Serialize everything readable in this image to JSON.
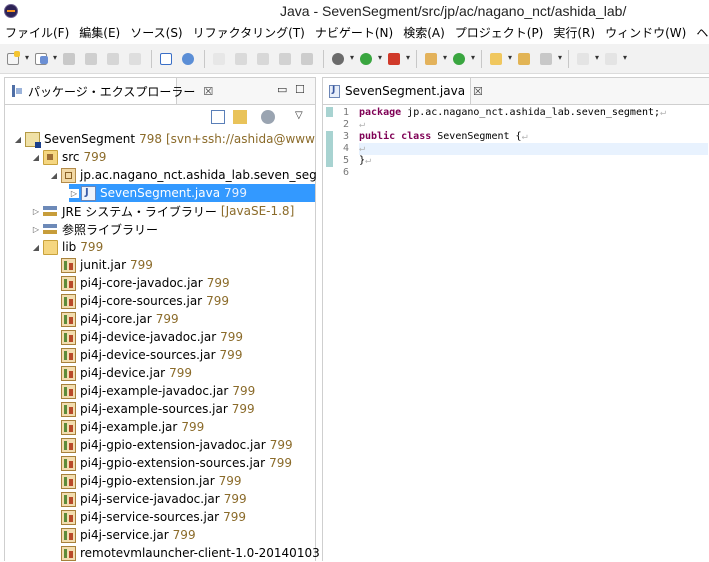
{
  "window": {
    "title": "Java - SevenSegment/src/jp/ac/nagano_nct/ashida_lab/"
  },
  "menubar": [
    {
      "label": "ファイル(F)"
    },
    {
      "label": "編集(E)"
    },
    {
      "label": "ソース(S)"
    },
    {
      "label": "リファクタリング(T)"
    },
    {
      "label": "ナビゲート(N)"
    },
    {
      "label": "検索(A)"
    },
    {
      "label": "プロジェクト(P)"
    },
    {
      "label": "実行(R)"
    },
    {
      "label": "ウィンドウ(W)"
    },
    {
      "label": "ヘルプ(H)"
    }
  ],
  "package_explorer": {
    "tab_label": "パッケージ・エクスプローラー",
    "close_glyph": "☒",
    "tree": [
      {
        "label": "SevenSegment",
        "rev": "798",
        "extra": "[svn+ssh://ashida@www",
        "icon": "project"
      },
      {
        "label": "src",
        "rev": "799",
        "icon": "src-folder"
      },
      {
        "label": "jp.ac.nagano_nct.ashida_lab.seven_seg",
        "rev": "",
        "icon": "package"
      },
      {
        "label": "SevenSegment.java",
        "rev": "799",
        "icon": "java-file"
      },
      {
        "label": "JRE システム・ライブラリー",
        "rev": "",
        "extra": "[JavaSE-1.8]",
        "icon": "library"
      },
      {
        "label": "参照ライブラリー",
        "rev": "",
        "icon": "library"
      },
      {
        "label": "lib",
        "rev": "799",
        "icon": "folder"
      },
      {
        "label": "junit.jar",
        "rev": "799",
        "icon": "jar"
      },
      {
        "label": "pi4j-core-javadoc.jar",
        "rev": "799",
        "icon": "jar"
      },
      {
        "label": "pi4j-core-sources.jar",
        "rev": "799",
        "icon": "jar"
      },
      {
        "label": "pi4j-core.jar",
        "rev": "799",
        "icon": "jar"
      },
      {
        "label": "pi4j-device-javadoc.jar",
        "rev": "799",
        "icon": "jar"
      },
      {
        "label": "pi4j-device-sources.jar",
        "rev": "799",
        "icon": "jar"
      },
      {
        "label": "pi4j-device.jar",
        "rev": "799",
        "icon": "jar"
      },
      {
        "label": "pi4j-example-javadoc.jar",
        "rev": "799",
        "icon": "jar"
      },
      {
        "label": "pi4j-example-sources.jar",
        "rev": "799",
        "icon": "jar"
      },
      {
        "label": "pi4j-example.jar",
        "rev": "799",
        "icon": "jar"
      },
      {
        "label": "pi4j-gpio-extension-javadoc.jar",
        "rev": "799",
        "icon": "jar"
      },
      {
        "label": "pi4j-gpio-extension-sources.jar",
        "rev": "799",
        "icon": "jar"
      },
      {
        "label": "pi4j-gpio-extension.jar",
        "rev": "799",
        "icon": "jar"
      },
      {
        "label": "pi4j-service-javadoc.jar",
        "rev": "799",
        "icon": "jar"
      },
      {
        "label": "pi4j-service-sources.jar",
        "rev": "799",
        "icon": "jar"
      },
      {
        "label": "pi4j-service.jar",
        "rev": "799",
        "icon": "jar"
      },
      {
        "label": "remotevmlauncher-client-1.0-20140103",
        "rev": "",
        "icon": "jar"
      }
    ],
    "selected_item": "SevenSegment.java"
  },
  "editor": {
    "tab_label": "SevenSegment.java",
    "close_glyph": "☒",
    "lines": [
      {
        "no": "1",
        "kw": "package",
        "text": " jp.ac.nagano_nct.ashida_lab.seven_segment;",
        "eol": "↵"
      },
      {
        "no": "2",
        "kw": "",
        "text": "",
        "eol": "↵"
      },
      {
        "no": "3",
        "kw": "public class",
        "text": " SevenSegment {",
        "eol": "↵"
      },
      {
        "no": "4",
        "kw": "",
        "text": "",
        "eol": "↵"
      },
      {
        "no": "5",
        "kw": "",
        "text": "}",
        "eol": "↵"
      },
      {
        "no": "6",
        "kw": "",
        "text": "",
        "eol": ""
      }
    ]
  }
}
